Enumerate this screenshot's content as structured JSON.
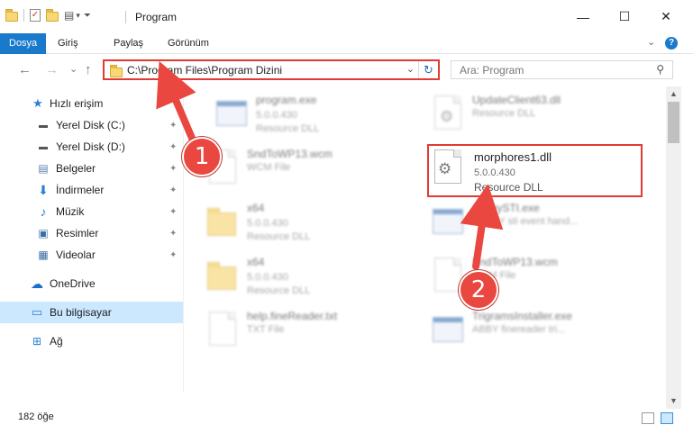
{
  "window": {
    "title": "Program",
    "minimize_glyph": "—",
    "maximize_glyph": "☐",
    "close_glyph": "✕"
  },
  "ribbon": {
    "tabs": [
      {
        "label": "Dosya",
        "active": true
      },
      {
        "label": "Giriş",
        "active": false
      },
      {
        "label": "Paylaş",
        "active": false
      },
      {
        "label": "Görünüm",
        "active": false
      }
    ],
    "help_glyph": "?",
    "chevron_glyph": "⌄"
  },
  "navigation": {
    "back_glyph": "←",
    "forward_glyph": "→",
    "recent_glyph": "⌄",
    "up_glyph": "↑",
    "address": "C:\\Program Files\\Program Dizini",
    "refresh_glyph": "↻",
    "dropdown_glyph": "⌄",
    "search_placeholder": "Ara: Program",
    "search_glyph": "⚲"
  },
  "sidebar": {
    "items": [
      {
        "label": "Hızlı erişim",
        "icon": "star-icon",
        "pinned": false
      },
      {
        "label": "Yerel Disk (C:)",
        "icon": "drive-icon",
        "pinned": true
      },
      {
        "label": "Yerel Disk (D:)",
        "icon": "drive-icon",
        "pinned": true
      },
      {
        "label": "Belgeler",
        "icon": "documents-icon",
        "pinned": true
      },
      {
        "label": "İndirmeler",
        "icon": "download-icon",
        "pinned": true
      },
      {
        "label": "Müzik",
        "icon": "music-icon",
        "pinned": true
      },
      {
        "label": "Resimler",
        "icon": "pictures-icon",
        "pinned": true
      },
      {
        "label": "Videolar",
        "icon": "videos-icon",
        "pinned": true
      },
      {
        "label": "OneDrive",
        "icon": "cloud-icon",
        "pinned": false
      },
      {
        "label": "Bu bilgisayar",
        "icon": "computer-icon",
        "pinned": false,
        "selected": true
      },
      {
        "label": "Ağ",
        "icon": "network-icon",
        "pinned": false
      }
    ],
    "pin_glyph": "📌"
  },
  "files": [
    {
      "name": "program.exe",
      "version": "5.0.0.430",
      "type": "Resource DLL",
      "icon": "exe-icon"
    },
    {
      "name": "UpdateClient63.dll",
      "version": "",
      "type": "Resource DLL",
      "icon": "dll-icon"
    },
    {
      "name": "SndToWP13.wcm",
      "version": "",
      "type": "WCM File",
      "icon": "file-icon"
    },
    {
      "name": "morphores1.dll",
      "version": "5.0.0.430",
      "type": "Resource DLL",
      "icon": "dll-icon",
      "highlighted": true
    },
    {
      "name": "x64",
      "version": "5.0.0.430",
      "type": "Resource DLL",
      "icon": "folder-icon"
    },
    {
      "name": "AbbyySTI.exe",
      "version": "",
      "type": "ABBYY sti event hand...",
      "icon": "exe-icon"
    },
    {
      "name": "x64",
      "version": "5.0.0.430",
      "type": "Resource DLL",
      "icon": "folder-icon"
    },
    {
      "name": "SndToWP13.wcm",
      "version": "",
      "type": "WCM File",
      "icon": "file-icon"
    },
    {
      "name": "help.fineReader.txt",
      "version": "",
      "type": "TXT File",
      "icon": "text-file-icon"
    },
    {
      "name": "TrigramsInstaller.exe",
      "version": "",
      "type": "ABBY finereader tri...",
      "icon": "exe-icon"
    }
  ],
  "annotations": {
    "badge1": "1",
    "badge2": "2",
    "color": "#e03b35"
  },
  "status": {
    "item_count": "182 öğe"
  },
  "colors": {
    "accent": "#1979ca",
    "selection": "#cce8ff",
    "annotation_red": "#e03b35"
  }
}
